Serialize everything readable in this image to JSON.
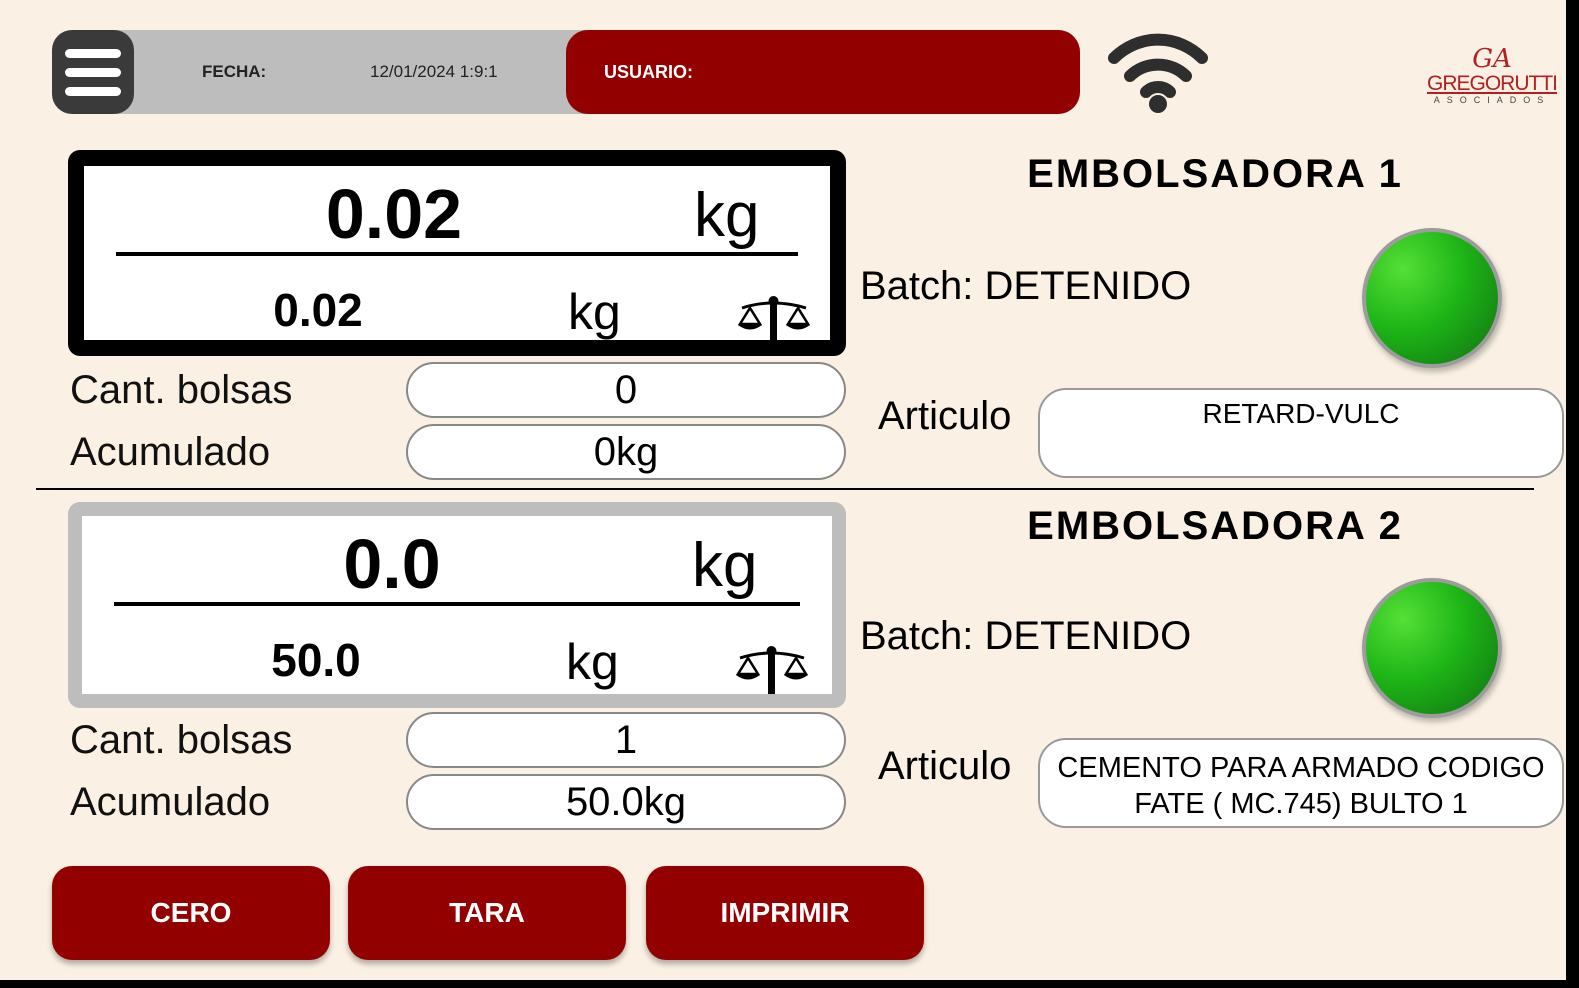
{
  "header": {
    "fecha_label": "FECHA:",
    "fecha_value": "12/01/2024 1:9:1",
    "usuario_label": "USUARIO:",
    "usuario_value": "",
    "logo_initials": "GA",
    "logo_brand": "GREGORUTTI",
    "logo_sub": "ASOCIADOS",
    "wifi_icon": "wifi-icon",
    "menu_icon": "hamburger-menu-icon"
  },
  "scales": [
    {
      "title": "EMBOLSADORA 1",
      "main_weight": "0.02",
      "main_unit": "kg",
      "secondary_weight": "0.02",
      "secondary_unit": "kg",
      "cant_bolsas_label": "Cant. bolsas",
      "cant_bolsas_value": "0",
      "acumulado_label": "Acumulado",
      "acumulado_value": "0kg",
      "batch_status": "Batch: DETENIDO",
      "articulo_label": "Articulo",
      "articulo_value": "RETARD-VULC",
      "status_color": "#1eb517",
      "selected": true
    },
    {
      "title": "EMBOLSADORA 2",
      "main_weight": "0.0",
      "main_unit": "kg",
      "secondary_weight": "50.0",
      "secondary_unit": "kg",
      "cant_bolsas_label": "Cant. bolsas",
      "cant_bolsas_value": "1",
      "acumulado_label": "Acumulado",
      "acumulado_value": "50.0kg",
      "batch_status": "Batch: DETENIDO",
      "articulo_label": "Articulo",
      "articulo_value": "CEMENTO PARA ARMADO CODIGO FATE ( MC.745) BULTO 1",
      "status_color": "#1eb517",
      "selected": false
    }
  ],
  "actions": {
    "cero": "CERO",
    "tara": "TARA",
    "imprimir": "IMPRIMIR"
  },
  "colors": {
    "background": "#faf1e4",
    "accent_red": "#930000",
    "header_gray": "#bdbdbd",
    "status_green": "#1eb517"
  }
}
